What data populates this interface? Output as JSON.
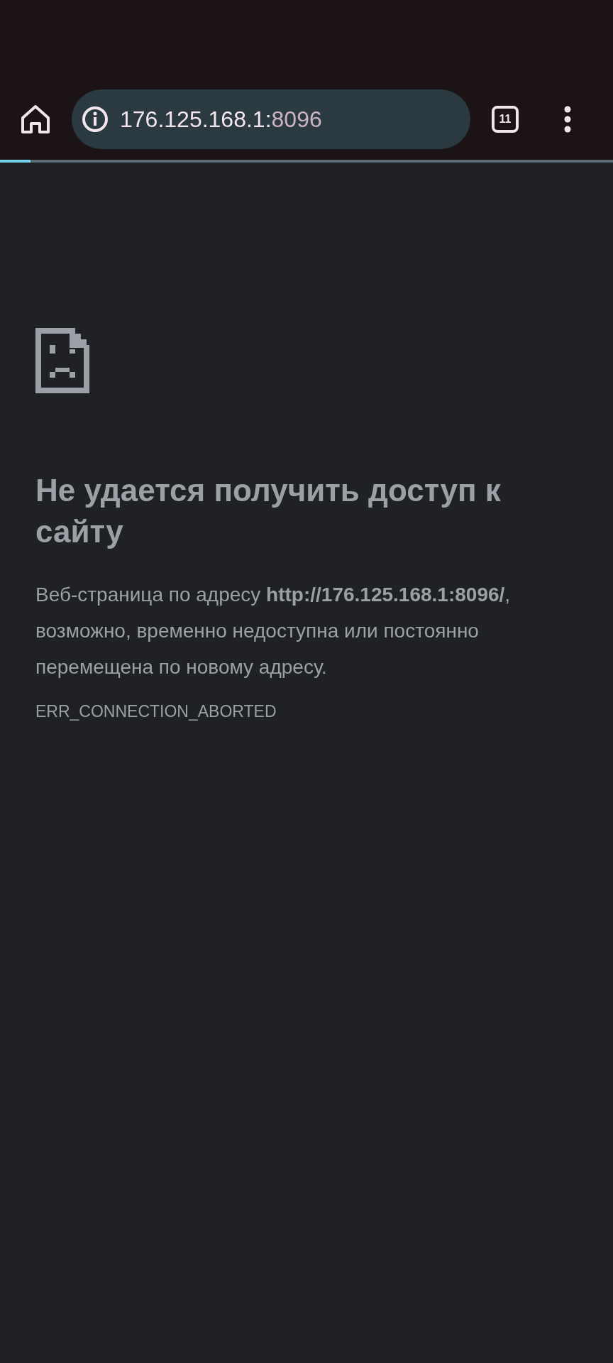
{
  "toolbar": {
    "url_host": "176.125.168.1:",
    "url_port": "8096",
    "tab_count": "11",
    "load_progress": {
      "level": 0.05
    }
  },
  "error_page": {
    "heading": "Не удается получить доступ к сайту",
    "message": "Веб-страница по адресу **http://176.125.168.1:8096/**, возможно, временно недоступна или постоянно перемещена по новому адресу.",
    "error_code": "ERR_CONNECTION_ABORTED"
  }
}
